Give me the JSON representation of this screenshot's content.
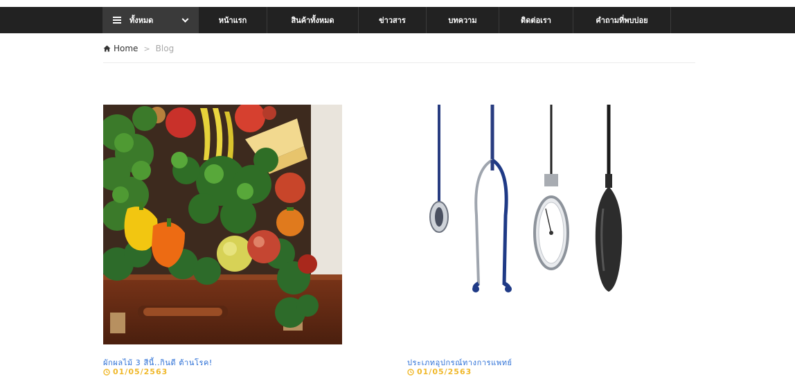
{
  "nav": {
    "category_label": "ทั้งหมด",
    "items": [
      {
        "label": "หน้าแรก"
      },
      {
        "label": "สินค้าทั้งหมด"
      },
      {
        "label": "ข่าวสาร"
      },
      {
        "label": "บทความ"
      },
      {
        "label": "ติดต่อเรา"
      },
      {
        "label": "คำถามที่พบบ่อย"
      }
    ]
  },
  "breadcrumb": {
    "home": "Home",
    "separator": ">",
    "current": "Blog"
  },
  "posts": [
    {
      "title": "ผักผลไม้ 3 สีนี้..กินดี ต้านโรค!",
      "date": "01/05/2563",
      "image": "vegetables-fruits-crate"
    },
    {
      "title": "ประเภทอุปกรณ์ทางการแพทย์",
      "date": "01/05/2563",
      "image": "medical-equipment-stethoscopes"
    }
  ],
  "colors": {
    "navbar": "#222222",
    "category_bg": "#3a3a3a",
    "title_link": "#2b6fd6",
    "date": "#f0b82b"
  }
}
